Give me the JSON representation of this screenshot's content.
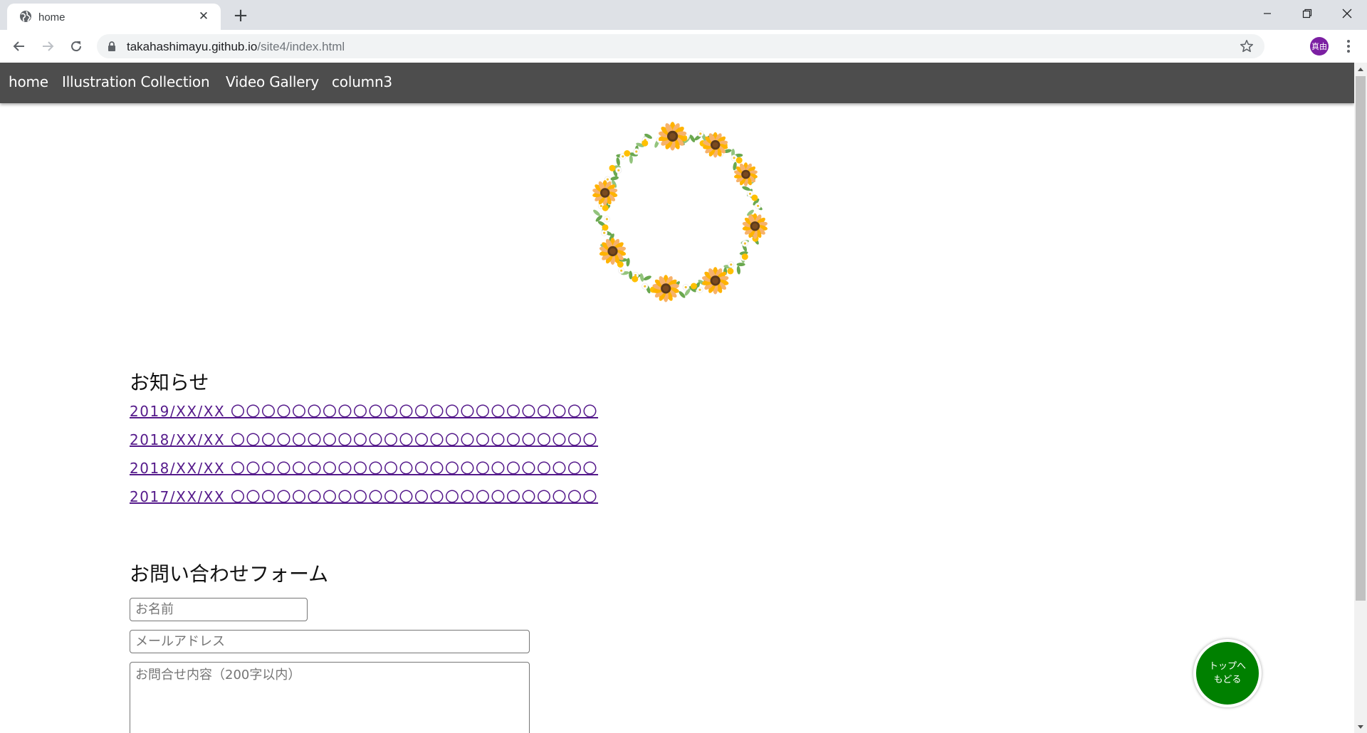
{
  "browser": {
    "tab_title": "home",
    "url_host": "takahashimayu.github.io",
    "url_path": "/site4/index.html",
    "profile_initials": "真由",
    "profile_color": "#7b1fa2"
  },
  "site_nav": {
    "items": [
      {
        "label": "home"
      },
      {
        "label": "Illustration Collection"
      },
      {
        "label": "Video Gallery"
      },
      {
        "label": "column3"
      }
    ],
    "background": "#4d4d4d"
  },
  "hero": {
    "image": "sunflower-wreath"
  },
  "news": {
    "title": "お知らせ",
    "items": [
      {
        "text": "2019/XX/XX 〇〇〇〇〇〇〇〇〇〇〇〇〇〇〇〇〇〇〇〇〇〇〇〇"
      },
      {
        "text": "2018/XX/XX 〇〇〇〇〇〇〇〇〇〇〇〇〇〇〇〇〇〇〇〇〇〇〇〇"
      },
      {
        "text": "2018/XX/XX 〇〇〇〇〇〇〇〇〇〇〇〇〇〇〇〇〇〇〇〇〇〇〇〇"
      },
      {
        "text": "2017/XX/XX 〇〇〇〇〇〇〇〇〇〇〇〇〇〇〇〇〇〇〇〇〇〇〇〇"
      }
    ],
    "link_color": "#551a8b"
  },
  "contact": {
    "title": "お問い合わせフォーム",
    "name_placeholder": "お名前",
    "email_placeholder": "メールアドレス",
    "message_placeholder": "お問合せ内容（200字以内）"
  },
  "back_to_top": {
    "line1": "トップへ",
    "line2": "もどる",
    "color": "#008000"
  }
}
